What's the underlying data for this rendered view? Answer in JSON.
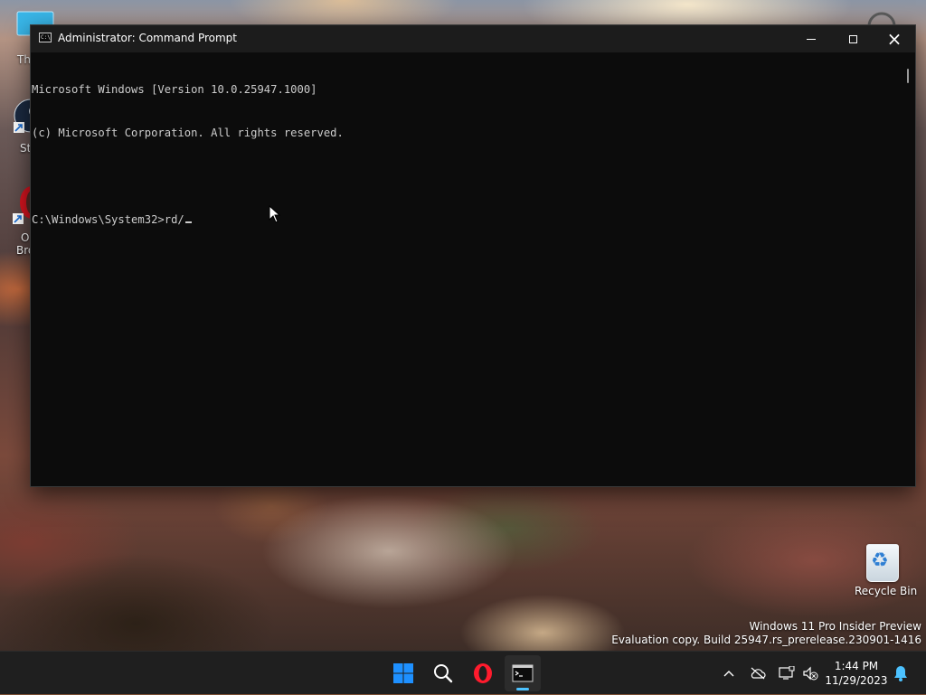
{
  "window": {
    "title": "Administrator: Command Prompt",
    "minimize_glyph": "minimize-icon",
    "maximize_glyph": "maximize-icon",
    "close_glyph": "×"
  },
  "console": {
    "lines": [
      "Microsoft Windows [Version 10.0.25947.1000]",
      "(c) Microsoft Corporation. All rights reserved.",
      "",
      "C:\\Windows\\System32>rd/"
    ]
  },
  "desktop": {
    "icons": [
      {
        "name": "this-pc",
        "label": "Th"
      },
      {
        "name": "steam",
        "label": "St"
      },
      {
        "name": "opera-browser",
        "label_line1": "O",
        "label_line2": "Bro"
      }
    ],
    "recycle_bin_label": "Recycle Bin",
    "recycle_symbol": "♻",
    "watermark_line1": "Windows 11 Pro Insider Preview",
    "watermark_line2": "Evaluation copy. Build 25947.rs_prerelease.230901-1416"
  },
  "taskbar": {
    "items": [
      "start-icon",
      "search-icon",
      "opera-icon",
      "command-prompt-icon"
    ],
    "time": "1:44 PM",
    "date": "11/29/2023"
  },
  "colors": {
    "console_bg": "#0c0c0c",
    "console_text": "#cccccc",
    "titlebar": "#1c1c1c",
    "taskbar": "#1f1f1f",
    "accent": "#4cc2ff",
    "start_blue": "#0a84ff",
    "opera_red": "#ff1b2d"
  }
}
